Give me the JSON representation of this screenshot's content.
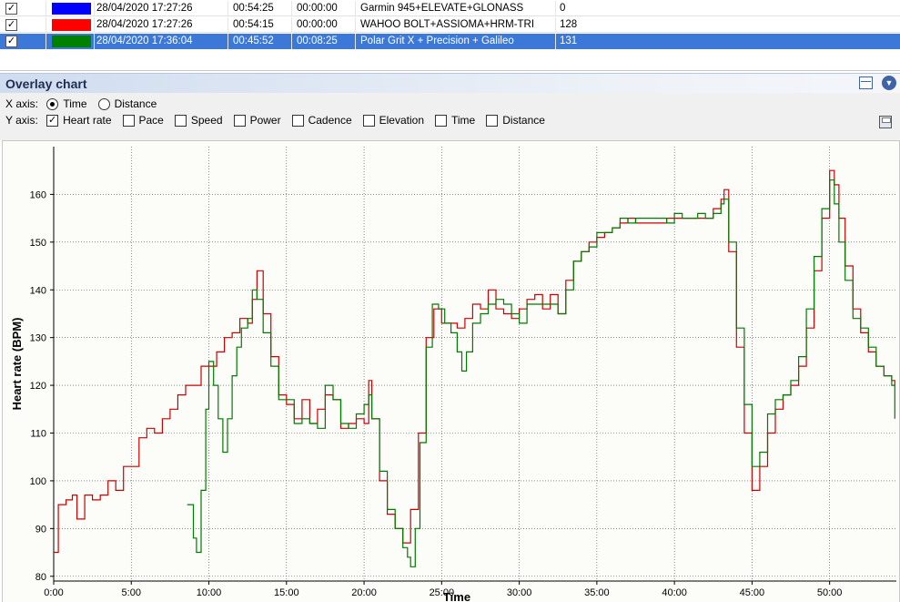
{
  "activities": [
    {
      "checked": "✓",
      "color": "#0000ff",
      "date": "28/04/2020 17:27:26",
      "duration": "00:54:25",
      "stopped": "00:00:00",
      "device": "Garmin 945+ELEVATE+GLONASS",
      "value": "0",
      "selected": false
    },
    {
      "checked": "✓",
      "color": "#ff0000",
      "date": "28/04/2020 17:27:26",
      "duration": "00:54:15",
      "stopped": "00:00:00",
      "device": "WAHOO BOLT+ASSIOMA+HRM-TRI",
      "value": "128",
      "selected": false
    },
    {
      "checked": "✓",
      "color": "#008000",
      "date": "28/04/2020 17:36:04",
      "duration": "00:45:52",
      "stopped": "00:08:25",
      "device": "Polar Grit X + Precision + Galileo",
      "value": "131",
      "selected": true
    }
  ],
  "panel": {
    "title": "Overlay chart",
    "layout_icon": "layout-icon",
    "menu_icon": "chevron-down-icon"
  },
  "options": {
    "x_axis_label": "X axis:",
    "x_options": [
      {
        "label": "Time",
        "selected": true
      },
      {
        "label": "Distance",
        "selected": false
      }
    ],
    "y_axis_label": "Y axis:",
    "y_options": [
      {
        "label": "Heart rate",
        "checked": true
      },
      {
        "label": "Pace",
        "checked": false
      },
      {
        "label": "Speed",
        "checked": false
      },
      {
        "label": "Power",
        "checked": false
      },
      {
        "label": "Cadence",
        "checked": false
      },
      {
        "label": "Elevation",
        "checked": false
      },
      {
        "label": "Time",
        "checked": false
      },
      {
        "label": "Distance",
        "checked": false
      }
    ],
    "save_icon": "save-icon"
  },
  "chart_data": {
    "type": "line",
    "xlabel": "Time",
    "ylabel": "Heart rate (BPM)",
    "xlim": [
      0,
      54.3
    ],
    "ylim": [
      79,
      170
    ],
    "x_ticks": [
      "0:00",
      "5:00",
      "10:00",
      "15:00",
      "20:00",
      "25:00",
      "30:00",
      "35:00",
      "40:00",
      "45:00",
      "50:00"
    ],
    "x_tick_values": [
      0,
      5,
      10,
      15,
      20,
      25,
      30,
      35,
      40,
      45,
      50
    ],
    "y_ticks": [
      "80",
      "90",
      "100",
      "110",
      "120",
      "130",
      "140",
      "150",
      "160"
    ],
    "y_tick_values": [
      80,
      90,
      100,
      110,
      120,
      130,
      140,
      150,
      160
    ],
    "grid": true,
    "series": [
      {
        "color": "#cc0000",
        "points": [
          [
            0,
            85
          ],
          [
            0.3,
            95
          ],
          [
            0.8,
            96
          ],
          [
            1.2,
            97
          ],
          [
            1.5,
            92
          ],
          [
            2,
            97
          ],
          [
            2.5,
            96
          ],
          [
            3,
            97
          ],
          [
            3.5,
            100
          ],
          [
            4,
            98
          ],
          [
            4.5,
            103
          ],
          [
            5,
            103
          ],
          [
            5.5,
            109
          ],
          [
            6,
            111
          ],
          [
            6.5,
            110
          ],
          [
            7,
            113
          ],
          [
            7.5,
            115
          ],
          [
            8,
            118
          ],
          [
            8.5,
            120
          ],
          [
            9,
            120
          ],
          [
            9.5,
            124
          ],
          [
            10,
            124
          ],
          [
            10.5,
            127
          ],
          [
            11,
            130
          ],
          [
            11.5,
            131
          ],
          [
            12,
            134
          ],
          [
            12.5,
            133
          ],
          [
            12.8,
            138
          ],
          [
            13.1,
            144
          ],
          [
            13.5,
            135
          ],
          [
            14,
            126
          ],
          [
            14.5,
            118
          ],
          [
            15,
            116
          ],
          [
            15.5,
            113
          ],
          [
            16,
            117
          ],
          [
            16.5,
            112
          ],
          [
            17,
            115
          ],
          [
            17.5,
            118
          ],
          [
            18,
            117
          ],
          [
            18.5,
            111
          ],
          [
            19,
            112
          ],
          [
            19.5,
            113
          ],
          [
            20,
            112
          ],
          [
            20.3,
            121
          ],
          [
            20.5,
            113
          ],
          [
            21,
            100
          ],
          [
            21.5,
            93
          ],
          [
            22,
            90
          ],
          [
            22.5,
            87
          ],
          [
            23,
            94
          ],
          [
            23.5,
            110
          ],
          [
            24,
            130
          ],
          [
            24.5,
            136
          ],
          [
            25,
            133
          ],
          [
            25.5,
            133
          ],
          [
            26,
            132
          ],
          [
            26.5,
            134
          ],
          [
            27,
            137
          ],
          [
            27.5,
            136
          ],
          [
            28,
            140
          ],
          [
            28.5,
            136
          ],
          [
            29,
            135
          ],
          [
            29.5,
            134
          ],
          [
            30,
            136
          ],
          [
            30.5,
            138
          ],
          [
            31,
            139
          ],
          [
            31.5,
            136
          ],
          [
            32,
            139
          ],
          [
            32.5,
            135
          ],
          [
            33,
            142
          ],
          [
            33.5,
            146
          ],
          [
            34,
            148
          ],
          [
            34.5,
            150
          ],
          [
            35,
            151
          ],
          [
            35.5,
            152
          ],
          [
            36,
            153
          ],
          [
            36.5,
            154
          ],
          [
            37,
            155
          ],
          [
            37.5,
            154
          ],
          [
            38,
            154
          ],
          [
            38.5,
            154
          ],
          [
            39,
            154
          ],
          [
            39.5,
            155
          ],
          [
            40,
            155
          ],
          [
            40.5,
            155
          ],
          [
            41,
            155
          ],
          [
            41.5,
            155
          ],
          [
            42,
            155
          ],
          [
            42.5,
            157
          ],
          [
            43,
            159
          ],
          [
            43.2,
            161
          ],
          [
            43.5,
            148
          ],
          [
            44,
            128
          ],
          [
            44.5,
            110
          ],
          [
            45,
            98
          ],
          [
            45.5,
            103
          ],
          [
            46,
            110
          ],
          [
            46.5,
            115
          ],
          [
            47,
            118
          ],
          [
            47.5,
            120
          ],
          [
            48,
            124
          ],
          [
            48.5,
            132
          ],
          [
            49,
            144
          ],
          [
            49.5,
            155
          ],
          [
            50,
            165
          ],
          [
            50.3,
            162
          ],
          [
            50.6,
            155
          ],
          [
            51,
            145
          ],
          [
            51.5,
            136
          ],
          [
            52,
            131
          ],
          [
            52.5,
            127
          ],
          [
            53,
            124
          ],
          [
            53.5,
            122
          ],
          [
            54,
            121
          ],
          [
            54.2,
            120
          ]
        ]
      },
      {
        "color": "#007a00",
        "points": [
          [
            8.6,
            95
          ],
          [
            9,
            88
          ],
          [
            9.2,
            85
          ],
          [
            9.5,
            98
          ],
          [
            9.8,
            115
          ],
          [
            10,
            125
          ],
          [
            10.3,
            120
          ],
          [
            10.6,
            113
          ],
          [
            10.9,
            106
          ],
          [
            11.2,
            113
          ],
          [
            11.5,
            122
          ],
          [
            11.8,
            128
          ],
          [
            12.1,
            132
          ],
          [
            12.5,
            134
          ],
          [
            12.8,
            140
          ],
          [
            13.1,
            138
          ],
          [
            13.5,
            131
          ],
          [
            14,
            124
          ],
          [
            14.5,
            117
          ],
          [
            15,
            117
          ],
          [
            15.5,
            112
          ],
          [
            16,
            113
          ],
          [
            16.5,
            112
          ],
          [
            17,
            111
          ],
          [
            17.5,
            120
          ],
          [
            18,
            117
          ],
          [
            18.5,
            112
          ],
          [
            19,
            111
          ],
          [
            19.5,
            114
          ],
          [
            20,
            116
          ],
          [
            20.3,
            118
          ],
          [
            20.5,
            113
          ],
          [
            21,
            102
          ],
          [
            21.5,
            94
          ],
          [
            22,
            90
          ],
          [
            22.5,
            86
          ],
          [
            22.8,
            84
          ],
          [
            23,
            82
          ],
          [
            23.3,
            90
          ],
          [
            23.6,
            108
          ],
          [
            24,
            128
          ],
          [
            24.4,
            137
          ],
          [
            24.8,
            136
          ],
          [
            25.2,
            133
          ],
          [
            25.6,
            131
          ],
          [
            26,
            127
          ],
          [
            26.3,
            123
          ],
          [
            26.6,
            127
          ],
          [
            27,
            133
          ],
          [
            27.5,
            135
          ],
          [
            28,
            137
          ],
          [
            28.5,
            138
          ],
          [
            29,
            137
          ],
          [
            29.5,
            135
          ],
          [
            30,
            133
          ],
          [
            30.5,
            137
          ],
          [
            31,
            137
          ],
          [
            31.5,
            137
          ],
          [
            32,
            137
          ],
          [
            32.5,
            135
          ],
          [
            33,
            140
          ],
          [
            33.5,
            146
          ],
          [
            34,
            148
          ],
          [
            34.5,
            149
          ],
          [
            35,
            152
          ],
          [
            35.5,
            152
          ],
          [
            36,
            153
          ],
          [
            36.5,
            155
          ],
          [
            37,
            154
          ],
          [
            37.5,
            155
          ],
          [
            38,
            155
          ],
          [
            38.5,
            155
          ],
          [
            39,
            155
          ],
          [
            39.5,
            154
          ],
          [
            40,
            156
          ],
          [
            40.5,
            155
          ],
          [
            41,
            155
          ],
          [
            41.5,
            156
          ],
          [
            42,
            155
          ],
          [
            42.5,
            156
          ],
          [
            43,
            158
          ],
          [
            43.2,
            159
          ],
          [
            43.5,
            150
          ],
          [
            44,
            132
          ],
          [
            44.5,
            116
          ],
          [
            45,
            103
          ],
          [
            45.5,
            106
          ],
          [
            46,
            114
          ],
          [
            46.5,
            117
          ],
          [
            47,
            118
          ],
          [
            47.5,
            121
          ],
          [
            48,
            126
          ],
          [
            48.5,
            136
          ],
          [
            49,
            147
          ],
          [
            49.5,
            157
          ],
          [
            50,
            163
          ],
          [
            50.3,
            158
          ],
          [
            50.6,
            150
          ],
          [
            51,
            142
          ],
          [
            51.5,
            134
          ],
          [
            52,
            132
          ],
          [
            52.5,
            128
          ],
          [
            53,
            124
          ],
          [
            53.5,
            122
          ],
          [
            54,
            120
          ],
          [
            54.2,
            113
          ]
        ]
      }
    ]
  }
}
